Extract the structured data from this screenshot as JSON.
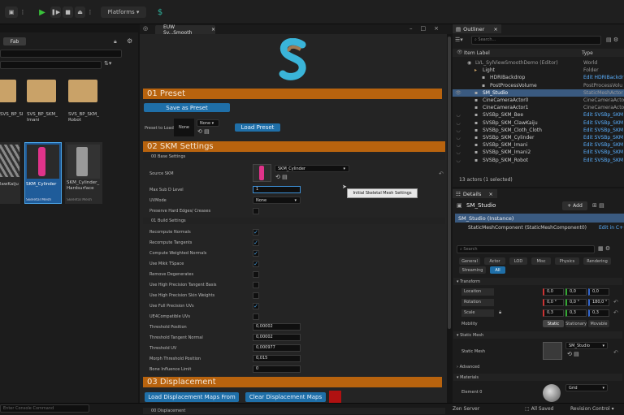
{
  "toolbar": {
    "platforms_label": "Platforms",
    "dots": "⋮"
  },
  "content_browser": {
    "fab_label": "Fab",
    "folders": [
      {
        "label": "SVS_BP_SKM_"
      },
      {
        "label": "SVS_BP_SKM_ Imani"
      },
      {
        "label": "SVS_BP_SKM_ Robot"
      }
    ],
    "assets": [
      {
        "label": "lawKaiju",
        "type": ""
      },
      {
        "label": "SKM_Cylinder",
        "type": "Skeletal Mesh"
      },
      {
        "label": "SKM_Cylinder_ Hardsurface",
        "type": "Skeletal Mesh"
      }
    ],
    "command_placeholder": "Enter Console Command"
  },
  "editor_tab": {
    "title": "EUW Sy...Smooth",
    "close": "×"
  },
  "tool": {
    "preset_header": "01 Preset",
    "save_preset": "Save as Preset",
    "preset_to_load": "Preset to Load",
    "preset_none": "None",
    "preset_dropdown": "None",
    "load_preset": "Load Preset",
    "skm_header": "02 SKM Settings",
    "base_settings": "00 Base Settings",
    "source_skm_label": "Source SKM",
    "source_skm_value": "SKM_Cylinder",
    "max_subd_label": "Max Sub D Level",
    "max_subd_value": "1",
    "tooltip": "Initial Skeletal Mesh Settings",
    "uvmode_label": "UVMode",
    "uvmode_value": "None",
    "preserve_label": "Preserve Hard Edges/ Creases",
    "build_settings": "01 Build Settings",
    "build_rows": [
      {
        "label": "Recompute Normals",
        "checked": true
      },
      {
        "label": "Recompute Tangents",
        "checked": true
      },
      {
        "label": "Compute Weighted Normals",
        "checked": true
      },
      {
        "label": "Use Mikk TSpace",
        "checked": true
      },
      {
        "label": "Remove Degenerates",
        "checked": false
      },
      {
        "label": "Use High Precision Tangent Basis",
        "checked": false
      },
      {
        "label": "Use High Precision Skin Weights",
        "checked": false
      },
      {
        "label": "Use Full Precision UVs",
        "checked": true
      },
      {
        "label": "UE4Compatible UVs",
        "checked": false
      }
    ],
    "numeric_rows": [
      {
        "label": "Threshold Position",
        "value": "0,00002"
      },
      {
        "label": "Threshold Tangent Normal",
        "value": "0,00002"
      },
      {
        "label": "Threshold UV",
        "value": "0,000977"
      },
      {
        "label": "Morph Threshold Position",
        "value": "0,015"
      },
      {
        "label": "Bone Influence Limit",
        "value": "0"
      }
    ],
    "displacement_header": "03 Displacement",
    "load_disp": "Load Displacement Maps From",
    "clear_disp": "Clear Displacement Maps",
    "disp_sub": "00 Displacement"
  },
  "outliner": {
    "title": "Outliner",
    "search_placeholder": "Search...",
    "col_label": "Item Label",
    "col_type": "Type",
    "rows": [
      {
        "label": "LVL_SylViewSmoothDemo (Editor)",
        "type": "World",
        "indent": 0
      },
      {
        "label": "Light",
        "type": "Folder",
        "indent": 1
      },
      {
        "label": "HDRIBackdrop",
        "type": "Edit HDRIBackdr",
        "indent": 2
      },
      {
        "label": "PostProcessVolume",
        "type": "PostProcessVolu",
        "indent": 2
      },
      {
        "label": "SM_Studio",
        "type": "StaticMeshActor",
        "indent": 1
      },
      {
        "label": "CineCameraActor0",
        "type": "CineCameraActor",
        "indent": 1
      },
      {
        "label": "CineCameraActor1",
        "type": "CineCameraActor",
        "indent": 1
      },
      {
        "label": "SVSBp_SKM_Bee",
        "type": "Edit SVSBp_SKM",
        "indent": 1
      },
      {
        "label": "SVSBp_SKM_ClawKaiju",
        "type": "Edit SVSBp_SKM",
        "indent": 1
      },
      {
        "label": "SVSBp_SKM_Cloth_Cloth",
        "type": "Edit SVSBp_SKM",
        "indent": 1
      },
      {
        "label": "SVSBp_SKM_Cylinder",
        "type": "Edit SVSBp_SKM",
        "indent": 1
      },
      {
        "label": "SVSBp_SKM_Imani",
        "type": "Edit SVSBp_SKM",
        "indent": 1
      },
      {
        "label": "SVSBp_SKM_Imani2",
        "type": "Edit SVSBp_SKM",
        "indent": 1
      },
      {
        "label": "SVSBp_SKM_Robot",
        "type": "Edit SVSBp_SKM",
        "indent": 1
      }
    ],
    "count": "13 actors (1 selected)"
  },
  "details": {
    "title": "Details",
    "actor": "SM_Studio",
    "add_label": "+ Add",
    "instance": "SM_Studio (Instance)",
    "component": "StaticMeshComponent (StaticMeshComponent0)",
    "edit_cpp": "Edit in C++",
    "search_placeholder": "Search",
    "tabs": [
      "General",
      "Actor",
      "LOD",
      "Misc",
      "Physics",
      "Rendering",
      "Streaming",
      "All"
    ],
    "transform": "Transform",
    "location": "Location",
    "rotation": "Rotation",
    "scale": "Scale",
    "loc": [
      "0,0",
      "0,0",
      "0,0"
    ],
    "rot": [
      "0,0 °",
      "0,0 °",
      "180,0 °"
    ],
    "scl": [
      "0,3",
      "0,3",
      "0,3"
    ],
    "mobility": "Mobility",
    "mob_opts": [
      "Static",
      "Stationary",
      "Movable"
    ],
    "static_mesh_head": "Static Mesh",
    "static_mesh_label": "Static Mesh",
    "static_mesh_value": "SM_Studio",
    "advanced": "Advanced",
    "materials": "Materials",
    "element0": "Element 0",
    "element0_value": "Grid"
  },
  "statusbar": {
    "zen": "Zen Server",
    "saved": "All Saved",
    "revision": "Revision Control"
  },
  "colors": {
    "accent_blue": "#1f6fa8",
    "section_orange": "#b8630e",
    "selection": "#3a5a80"
  }
}
